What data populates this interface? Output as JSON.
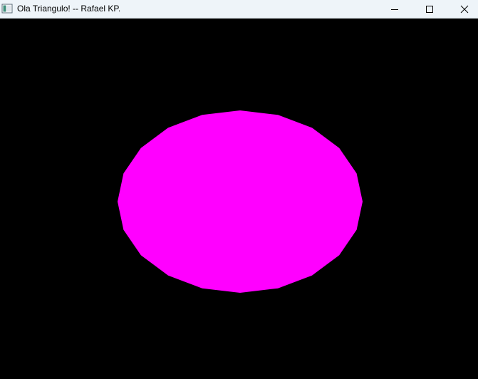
{
  "window": {
    "title": "Ola Triangulo! -- Rafael KP.",
    "app_icon": "window-app-icon",
    "controls": {
      "minimize_icon": "minimize-icon",
      "maximize_icon": "maximize-icon",
      "close_icon": "close-icon"
    }
  },
  "canvas": {
    "background_color": "#000000",
    "shape": {
      "kind": "circle-polygon",
      "fill_color": "#ff00ff",
      "segments": 20
    }
  }
}
